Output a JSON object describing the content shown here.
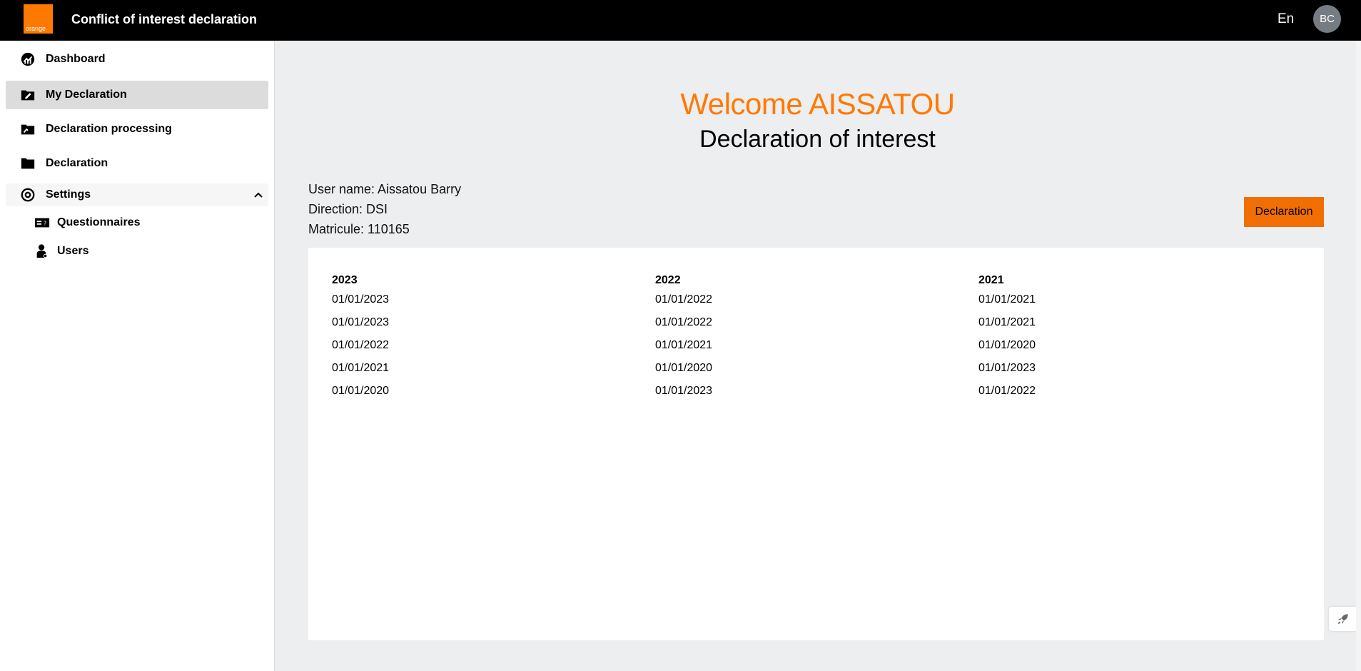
{
  "header": {
    "logo_text": "orange",
    "title": "Conflict of interest declaration",
    "language": "En",
    "avatar_initials": "BC"
  },
  "sidebar": {
    "items": [
      {
        "label": "Dashboard",
        "icon": "dashboard-icon"
      },
      {
        "label": "My Declaration",
        "icon": "edit-folder-icon",
        "active": true
      },
      {
        "label": "Declaration processing",
        "icon": "folder-processing-icon"
      },
      {
        "label": "Declaration",
        "icon": "folder-icon"
      },
      {
        "label": "Settings",
        "icon": "gear-icon",
        "expanded": true
      }
    ],
    "sub_items": [
      {
        "label": "Questionnaires",
        "icon": "questionnaire-icon"
      },
      {
        "label": "Users",
        "icon": "user-icon"
      }
    ]
  },
  "main": {
    "welcome": "Welcome AISSATOU",
    "subtitle": "Declaration of interest",
    "user_name": "User name: Aissatou Barry",
    "direction": "Direction: DSI",
    "matricule": "Matricule: 110165",
    "declaration_button": "Declaration",
    "accent_color": "#ff7900",
    "columns": [
      {
        "header": "2023",
        "rows": [
          "01/01/2023",
          "01/01/2023",
          "01/01/2022",
          "01/01/2021",
          "01/01/2020"
        ]
      },
      {
        "header": "2022",
        "rows": [
          "01/01/2022",
          "01/01/2022",
          "01/01/2021",
          "01/01/2020",
          "01/01/2023"
        ]
      },
      {
        "header": "2021",
        "rows": [
          "01/01/2021",
          "01/01/2021",
          "01/01/2020",
          "01/01/2023",
          "01/01/2022"
        ]
      }
    ]
  }
}
